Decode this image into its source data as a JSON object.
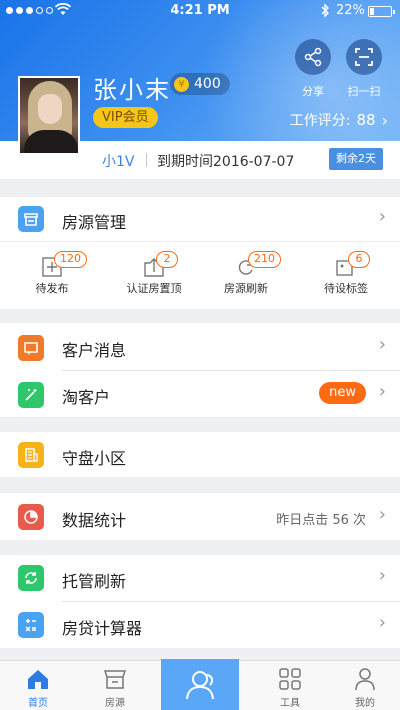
{
  "status": {
    "time": "4:21 PM",
    "battery": "22%",
    "battery_level": 0.22
  },
  "profile": {
    "name": "张小末",
    "coins": "400",
    "vip": "VIP会员",
    "share_label": "分享",
    "scan_label": "扫一扫",
    "score_label": "工作评分:",
    "score_value": "88",
    "level": "小1V",
    "expire": "到期时间2016-07-07",
    "remaining": "剩余2天"
  },
  "house": {
    "title": "房源管理",
    "items": [
      {
        "label": "待发布",
        "count": "120",
        "icon": "add-box-icon"
      },
      {
        "label": "认证房置顶",
        "count": "2",
        "icon": "upload-box-icon"
      },
      {
        "label": "房源刷新",
        "count": "210",
        "icon": "refresh-icon"
      },
      {
        "label": "待设标签",
        "count": "6",
        "icon": "tag-icon"
      }
    ]
  },
  "menu": {
    "customer_msg": "客户消息",
    "tao_customer": "淘客户",
    "new_badge": "new",
    "guard_area": "守盘小区",
    "stats": "数据统计",
    "stats_right": "昨日点击 56 次",
    "hosting_refresh": "托管刷新",
    "loan_calc": "房贷计算器"
  },
  "tabs": [
    "首页",
    "房源",
    "",
    "工具",
    "我的"
  ],
  "colors": {
    "primary": "#2e7be6",
    "orange": "#f07a2b",
    "green": "#2ec76b",
    "yellow": "#f5b317",
    "red": "#e85a4b",
    "blue_icon": "#4aa3f0",
    "badge": "#ff6a13"
  }
}
